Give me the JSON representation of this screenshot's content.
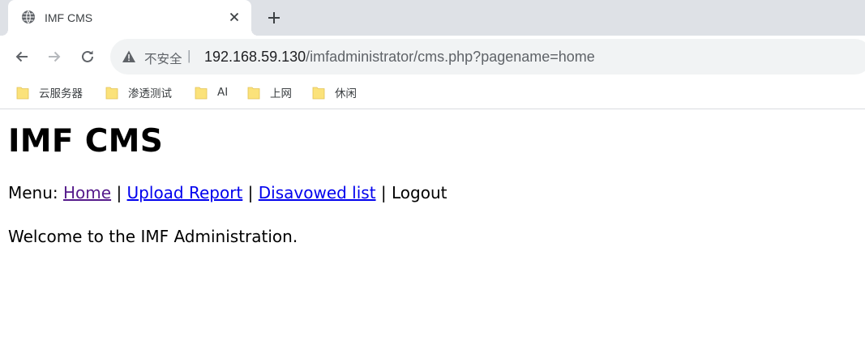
{
  "browser": {
    "tab": {
      "title": "IMF CMS",
      "favicon": "globe-icon"
    },
    "new_tab_icon": "plus-icon",
    "toolbar": {
      "back_icon": "arrow-left-icon",
      "forward_icon": "arrow-right-icon",
      "reload_icon": "reload-icon",
      "security_icon": "warning-triangle-icon",
      "security_label": "不安全",
      "url_host": "192.168.59.130",
      "url_path": "/imfadministrator/cms.php?pagename=home"
    },
    "bookmarks": [
      {
        "label": "云服务器",
        "icon": "folder-icon"
      },
      {
        "label": "渗透测试",
        "icon": "folder-icon"
      },
      {
        "label": "AI",
        "icon": "folder-icon"
      },
      {
        "label": "上网",
        "icon": "folder-icon"
      },
      {
        "label": "休闲",
        "icon": "folder-icon"
      }
    ]
  },
  "page": {
    "title": "IMF CMS",
    "menu": {
      "prefix": "Menu:",
      "separator": "|",
      "links": [
        "Home",
        "Upload Report",
        "Disavowed list"
      ],
      "logout": "Logout"
    },
    "welcome": "Welcome to the IMF Administration."
  },
  "colors": {
    "tab_strip": "#dee1e6",
    "omnibox": "#f1f3f4",
    "link": "#0000ee",
    "visited_link": "#551a8b",
    "folder": "#fbe27a"
  }
}
